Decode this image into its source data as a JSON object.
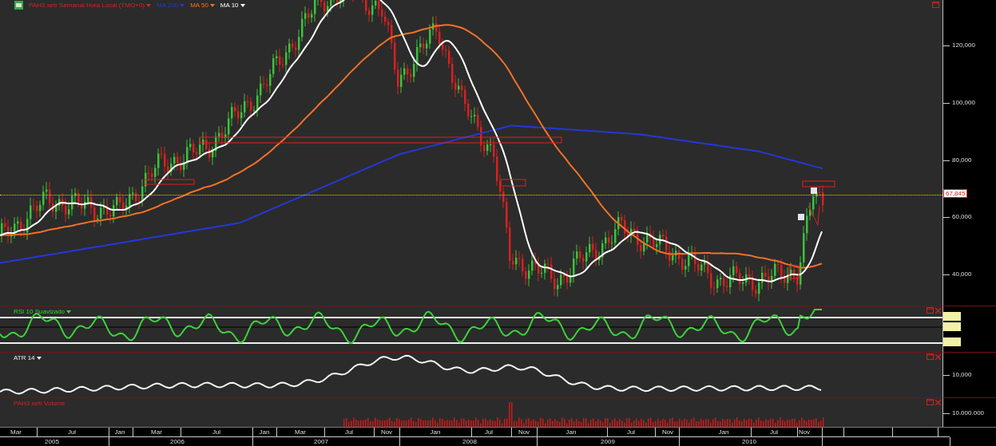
{
  "legend": [
    {
      "text": "PAH3.xetr Semanal Hora Local (TMO+0)",
      "color": "#d8202a"
    },
    {
      "text": "MA 200",
      "color": "#2438d8"
    },
    {
      "text": "MA 50",
      "color": "#f07228"
    },
    {
      "text": "MA 10",
      "color": "#ffffff"
    }
  ],
  "price_pane": {
    "ticks": [
      "120,000",
      "100,000",
      "80,000",
      "60,000",
      "40,000"
    ],
    "last_price": "67,845"
  },
  "rsi_pane": {
    "title": "RSI 10 Suavizado"
  },
  "atr_pane": {
    "title": "ATR 14",
    "ticks": [
      "10,000"
    ]
  },
  "volume_pane": {
    "title": "PAH3.xetr Volume",
    "ticks": [
      "10.000.000"
    ]
  },
  "time_axis": {
    "months": [
      "Mar",
      "Jul",
      "Jan",
      "Mar",
      "Jul",
      "Jan",
      "Mar",
      "Jul",
      "Nov",
      "Jan",
      "Jul",
      "Nov",
      "Jan",
      "Jul",
      "Nov",
      "Jan",
      "Jul",
      "Nov"
    ],
    "years": [
      "2005",
      "2006",
      "2007",
      "2008",
      "2009",
      "2010"
    ]
  }
}
